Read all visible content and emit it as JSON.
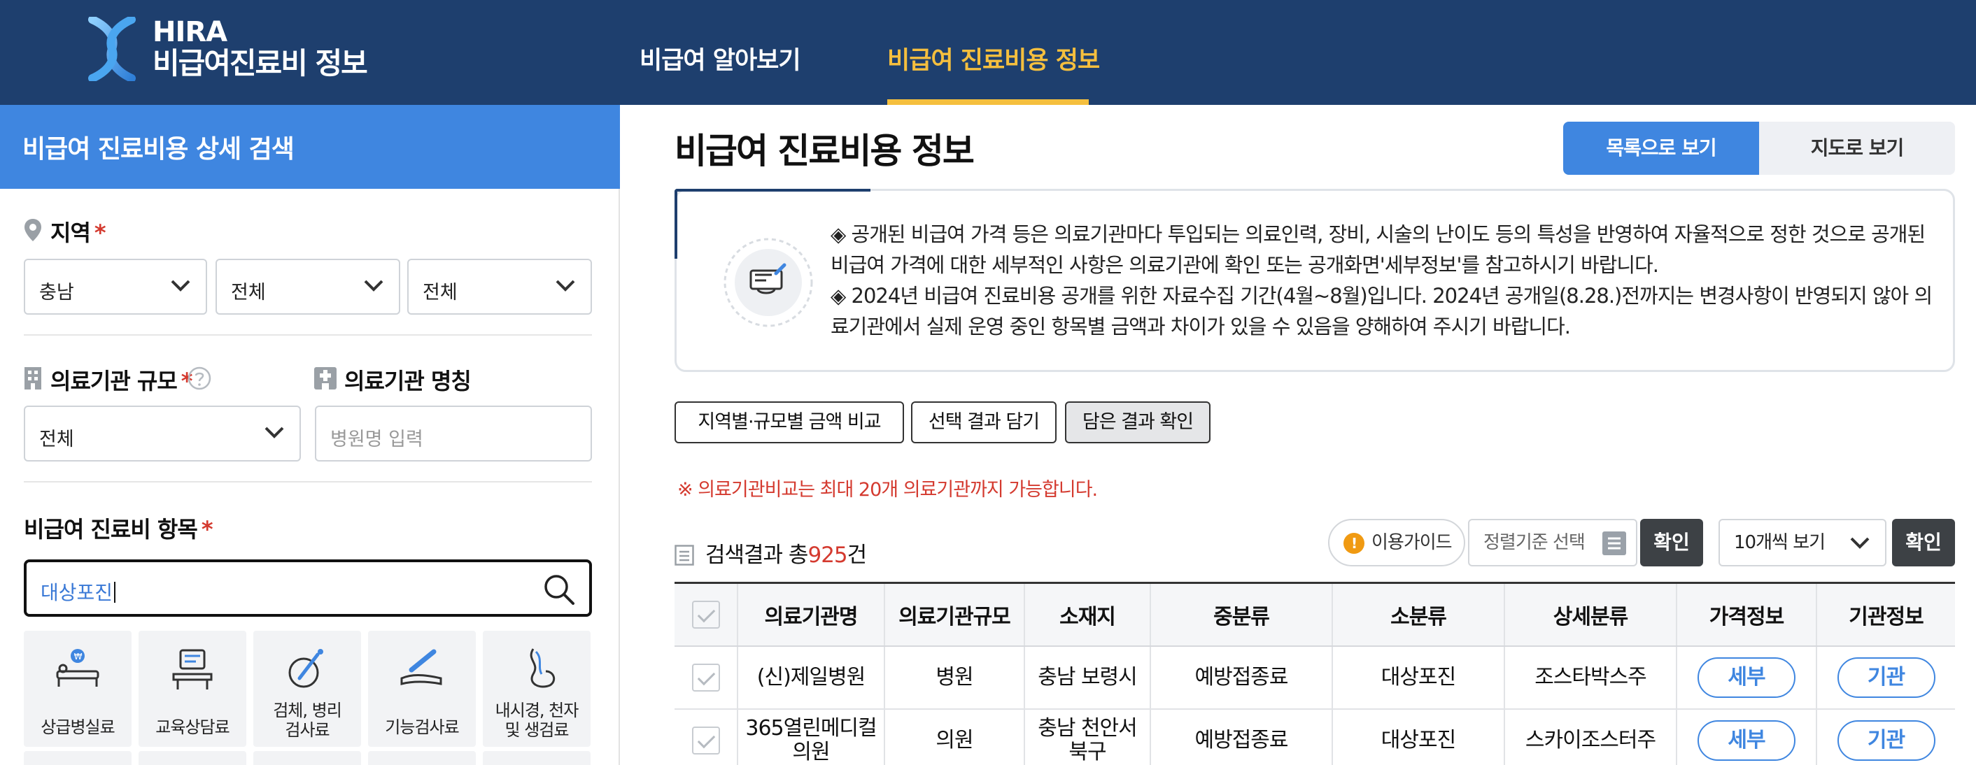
{
  "header": {
    "logo_line1": "HIRA",
    "logo_line2": "비급여진료비 정보",
    "nav": [
      {
        "label": "비급여 알아보기",
        "active": false
      },
      {
        "label": "비급여 진료비용 정보",
        "active": true
      }
    ],
    "colors": {
      "bar": "#1e3f6e",
      "active": "#f5bf3e"
    }
  },
  "sidebar": {
    "title": "비급여 진료비용 상세 검색",
    "region": {
      "label": "지역",
      "required_mark": "*",
      "selects": [
        "충남",
        "전체",
        "전체"
      ]
    },
    "size": {
      "label": "의료기관 규모",
      "required_mark": "*",
      "value": "전체"
    },
    "name": {
      "label": "의료기관 명칭",
      "placeholder": "병원명 입력"
    },
    "item": {
      "label": "비급여 진료비 항목",
      "required_mark": "*",
      "search_value": "대상포진"
    },
    "categories": [
      {
        "label": "상급병실료",
        "icon": "bed-icon"
      },
      {
        "label": "교육상담료",
        "icon": "counseling-icon"
      },
      {
        "label": "검체, 병리\n검사료",
        "icon": "specimen-icon"
      },
      {
        "label": "기능검사료",
        "icon": "injection-icon"
      },
      {
        "label": "내시경, 천자\n및 생검료",
        "icon": "endoscope-icon"
      }
    ]
  },
  "main": {
    "title": "비급여 진료비용 정보",
    "view_list": "목록으로 보기",
    "view_map": "지도로 보기",
    "notice": [
      "◈ 공개된 비급여 가격 등은 의료기관마다 투입되는 의료인력, 장비, 시술의 난이도 등의 특성을 반영하여 자율적으로 정한 것으로 공개된 비급여 가격에 대한 세부적인 사항은 의료기관에 확인 또는 공개화면'세부정보'를 참고하시기 바랍니다.",
      "◈ 2024년 비급여 진료비용 공개를 위한 자료수집 기간(4월~8월)입니다. 2024년 공개일(8.28.)전까지는 변경사항이 반영되지 않아 의료기관에서 실제 운영 중인 항목별 금액과 차이가 있을 수 있음을 양해하여 주시기 바랍니다."
    ],
    "actions": [
      "지역별·규모별 금액 비교",
      "선택 결과 담기",
      "담은 결과 확인"
    ],
    "warning": "※ 의료기관비교는 최대 20개 의료기관까지 가능합니다.",
    "result_prefix": "검색결과 총",
    "result_count": "925",
    "result_suffix": "건",
    "guide": "이용가이드",
    "sort": "정렬기준 선택",
    "confirm": "확인",
    "per_page": "10개씩 보기",
    "confirm2": "확인",
    "table": {
      "headers": [
        "의료기관명",
        "의료기관규모",
        "소재지",
        "중분류",
        "소분류",
        "상세분류",
        "가격정보",
        "기관정보"
      ],
      "rows": [
        {
          "name": "(신)제일병원",
          "size": "병원",
          "location": "충남 보령시",
          "mid": "예방접종료",
          "sub": "대상포진",
          "detail": "조스타박스주",
          "price": "세부",
          "inst": "기관"
        },
        {
          "name": "365열린메디컬\n의원",
          "size": "의원",
          "location": "충남 천안서\n북구",
          "mid": "예방접종료",
          "sub": "대상포진",
          "detail": "스카이조스터주",
          "price": "세부",
          "inst": "기관"
        }
      ]
    },
    "colors": {
      "accent": "#3f86e0",
      "warning": "#d43a2f"
    }
  }
}
